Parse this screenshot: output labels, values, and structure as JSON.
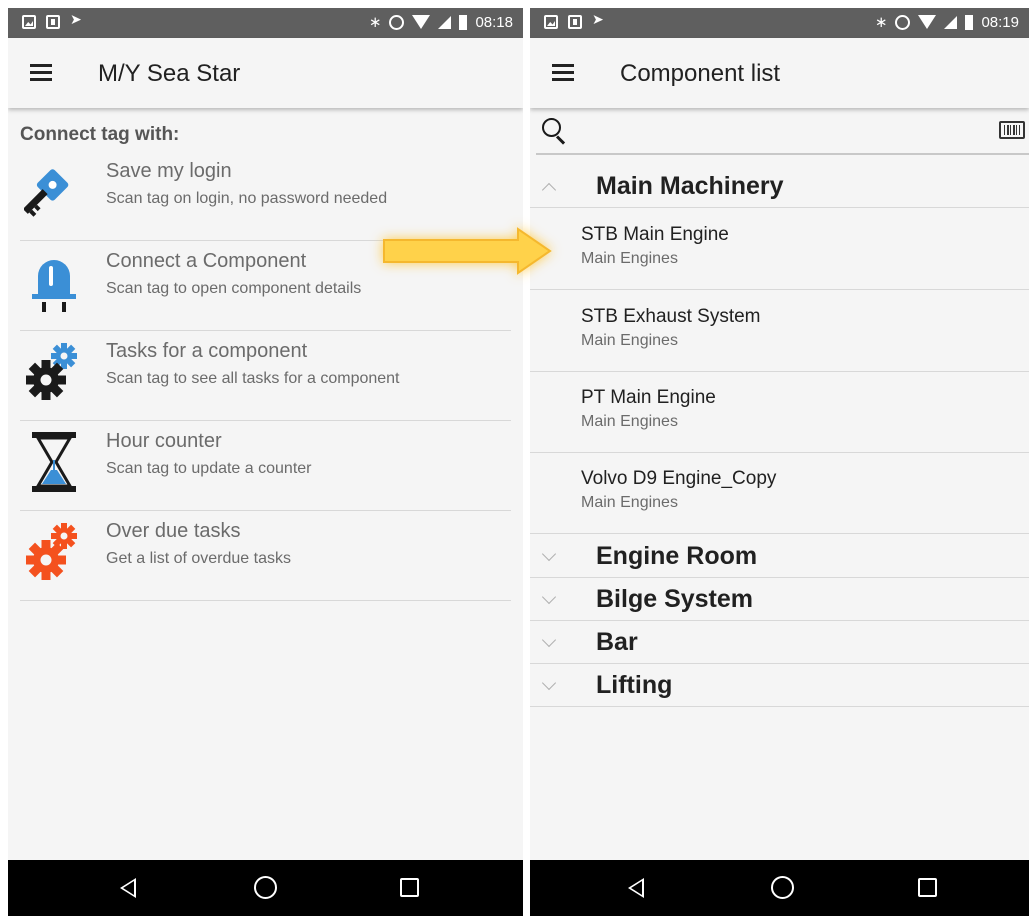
{
  "left_screen": {
    "status_bar": {
      "time": "08:18"
    },
    "app_bar": {
      "title": "M/Y Sea Star"
    },
    "section_title": "Connect tag with:",
    "menu_items": [
      {
        "title": "Save my login",
        "subtitle": "Scan tag on login, no password needed",
        "icon": "key-icon"
      },
      {
        "title": "Connect a Component",
        "subtitle": "Scan tag to open component details",
        "icon": "plug-icon"
      },
      {
        "title": "Tasks for a component",
        "subtitle": "Scan tag to see all tasks for a component",
        "icon": "gears-icon"
      },
      {
        "title": "Hour counter",
        "subtitle": "Scan tag to update a counter",
        "icon": "hourglass-icon"
      },
      {
        "title": "Over due tasks",
        "subtitle": "Get a list of overdue tasks",
        "icon": "red-gears-icon"
      }
    ]
  },
  "right_screen": {
    "status_bar": {
      "time": "08:19"
    },
    "app_bar": {
      "title": "Component list"
    },
    "search": {
      "placeholder": ""
    },
    "groups": [
      {
        "title": "Main Machinery",
        "expanded": true,
        "items": [
          {
            "title": "STB Main Engine",
            "subtitle": "Main Engines"
          },
          {
            "title": "STB Exhaust System",
            "subtitle": "Main Engines"
          },
          {
            "title": "PT Main Engine",
            "subtitle": "Main Engines"
          },
          {
            "title": "Volvo D9 Engine_Copy",
            "subtitle": "Main Engines"
          }
        ]
      },
      {
        "title": "Engine Room",
        "expanded": false
      },
      {
        "title": "Bilge System",
        "expanded": false
      },
      {
        "title": "Bar",
        "expanded": false
      },
      {
        "title": "Lifting",
        "expanded": false
      }
    ]
  },
  "colors": {
    "accent_blue": "#3b8fd6",
    "accent_red": "#f4511e",
    "arrow_yellow": "#ffd24a",
    "status_bar": "#5f5f5f"
  }
}
